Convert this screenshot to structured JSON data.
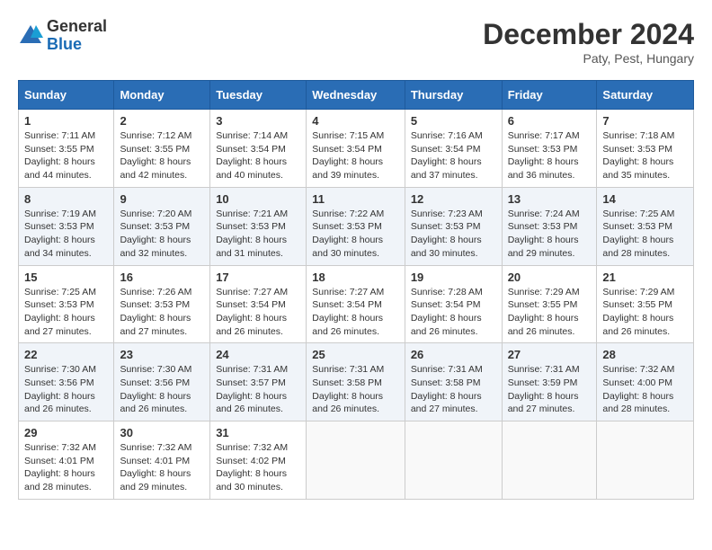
{
  "header": {
    "logo_general": "General",
    "logo_blue": "Blue",
    "month_title": "December 2024",
    "location": "Paty, Pest, Hungary"
  },
  "days_of_week": [
    "Sunday",
    "Monday",
    "Tuesday",
    "Wednesday",
    "Thursday",
    "Friday",
    "Saturday"
  ],
  "weeks": [
    [
      {
        "day": "1",
        "sunrise": "Sunrise: 7:11 AM",
        "sunset": "Sunset: 3:55 PM",
        "daylight": "Daylight: 8 hours and 44 minutes."
      },
      {
        "day": "2",
        "sunrise": "Sunrise: 7:12 AM",
        "sunset": "Sunset: 3:55 PM",
        "daylight": "Daylight: 8 hours and 42 minutes."
      },
      {
        "day": "3",
        "sunrise": "Sunrise: 7:14 AM",
        "sunset": "Sunset: 3:54 PM",
        "daylight": "Daylight: 8 hours and 40 minutes."
      },
      {
        "day": "4",
        "sunrise": "Sunrise: 7:15 AM",
        "sunset": "Sunset: 3:54 PM",
        "daylight": "Daylight: 8 hours and 39 minutes."
      },
      {
        "day": "5",
        "sunrise": "Sunrise: 7:16 AM",
        "sunset": "Sunset: 3:54 PM",
        "daylight": "Daylight: 8 hours and 37 minutes."
      },
      {
        "day": "6",
        "sunrise": "Sunrise: 7:17 AM",
        "sunset": "Sunset: 3:53 PM",
        "daylight": "Daylight: 8 hours and 36 minutes."
      },
      {
        "day": "7",
        "sunrise": "Sunrise: 7:18 AM",
        "sunset": "Sunset: 3:53 PM",
        "daylight": "Daylight: 8 hours and 35 minutes."
      }
    ],
    [
      {
        "day": "8",
        "sunrise": "Sunrise: 7:19 AM",
        "sunset": "Sunset: 3:53 PM",
        "daylight": "Daylight: 8 hours and 34 minutes."
      },
      {
        "day": "9",
        "sunrise": "Sunrise: 7:20 AM",
        "sunset": "Sunset: 3:53 PM",
        "daylight": "Daylight: 8 hours and 32 minutes."
      },
      {
        "day": "10",
        "sunrise": "Sunrise: 7:21 AM",
        "sunset": "Sunset: 3:53 PM",
        "daylight": "Daylight: 8 hours and 31 minutes."
      },
      {
        "day": "11",
        "sunrise": "Sunrise: 7:22 AM",
        "sunset": "Sunset: 3:53 PM",
        "daylight": "Daylight: 8 hours and 30 minutes."
      },
      {
        "day": "12",
        "sunrise": "Sunrise: 7:23 AM",
        "sunset": "Sunset: 3:53 PM",
        "daylight": "Daylight: 8 hours and 30 minutes."
      },
      {
        "day": "13",
        "sunrise": "Sunrise: 7:24 AM",
        "sunset": "Sunset: 3:53 PM",
        "daylight": "Daylight: 8 hours and 29 minutes."
      },
      {
        "day": "14",
        "sunrise": "Sunrise: 7:25 AM",
        "sunset": "Sunset: 3:53 PM",
        "daylight": "Daylight: 8 hours and 28 minutes."
      }
    ],
    [
      {
        "day": "15",
        "sunrise": "Sunrise: 7:25 AM",
        "sunset": "Sunset: 3:53 PM",
        "daylight": "Daylight: 8 hours and 27 minutes."
      },
      {
        "day": "16",
        "sunrise": "Sunrise: 7:26 AM",
        "sunset": "Sunset: 3:53 PM",
        "daylight": "Daylight: 8 hours and 27 minutes."
      },
      {
        "day": "17",
        "sunrise": "Sunrise: 7:27 AM",
        "sunset": "Sunset: 3:54 PM",
        "daylight": "Daylight: 8 hours and 26 minutes."
      },
      {
        "day": "18",
        "sunrise": "Sunrise: 7:27 AM",
        "sunset": "Sunset: 3:54 PM",
        "daylight": "Daylight: 8 hours and 26 minutes."
      },
      {
        "day": "19",
        "sunrise": "Sunrise: 7:28 AM",
        "sunset": "Sunset: 3:54 PM",
        "daylight": "Daylight: 8 hours and 26 minutes."
      },
      {
        "day": "20",
        "sunrise": "Sunrise: 7:29 AM",
        "sunset": "Sunset: 3:55 PM",
        "daylight": "Daylight: 8 hours and 26 minutes."
      },
      {
        "day": "21",
        "sunrise": "Sunrise: 7:29 AM",
        "sunset": "Sunset: 3:55 PM",
        "daylight": "Daylight: 8 hours and 26 minutes."
      }
    ],
    [
      {
        "day": "22",
        "sunrise": "Sunrise: 7:30 AM",
        "sunset": "Sunset: 3:56 PM",
        "daylight": "Daylight: 8 hours and 26 minutes."
      },
      {
        "day": "23",
        "sunrise": "Sunrise: 7:30 AM",
        "sunset": "Sunset: 3:56 PM",
        "daylight": "Daylight: 8 hours and 26 minutes."
      },
      {
        "day": "24",
        "sunrise": "Sunrise: 7:31 AM",
        "sunset": "Sunset: 3:57 PM",
        "daylight": "Daylight: 8 hours and 26 minutes."
      },
      {
        "day": "25",
        "sunrise": "Sunrise: 7:31 AM",
        "sunset": "Sunset: 3:58 PM",
        "daylight": "Daylight: 8 hours and 26 minutes."
      },
      {
        "day": "26",
        "sunrise": "Sunrise: 7:31 AM",
        "sunset": "Sunset: 3:58 PM",
        "daylight": "Daylight: 8 hours and 27 minutes."
      },
      {
        "day": "27",
        "sunrise": "Sunrise: 7:31 AM",
        "sunset": "Sunset: 3:59 PM",
        "daylight": "Daylight: 8 hours and 27 minutes."
      },
      {
        "day": "28",
        "sunrise": "Sunrise: 7:32 AM",
        "sunset": "Sunset: 4:00 PM",
        "daylight": "Daylight: 8 hours and 28 minutes."
      }
    ],
    [
      {
        "day": "29",
        "sunrise": "Sunrise: 7:32 AM",
        "sunset": "Sunset: 4:01 PM",
        "daylight": "Daylight: 8 hours and 28 minutes."
      },
      {
        "day": "30",
        "sunrise": "Sunrise: 7:32 AM",
        "sunset": "Sunset: 4:01 PM",
        "daylight": "Daylight: 8 hours and 29 minutes."
      },
      {
        "day": "31",
        "sunrise": "Sunrise: 7:32 AM",
        "sunset": "Sunset: 4:02 PM",
        "daylight": "Daylight: 8 hours and 30 minutes."
      },
      null,
      null,
      null,
      null
    ]
  ]
}
